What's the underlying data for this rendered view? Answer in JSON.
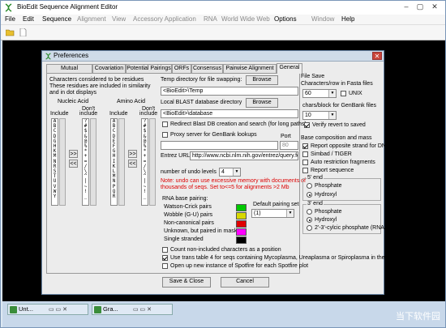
{
  "app": {
    "title": "BioEdit Sequence Alignment Editor"
  },
  "window_controls": {
    "minimize": "–",
    "maximize": "▢",
    "close": "✕"
  },
  "menu": [
    "File",
    "Edit",
    "Sequence",
    "Alignment",
    "View",
    "Accessory Application",
    "RNA",
    "World Wide Web",
    "Options",
    "Window",
    "Help"
  ],
  "dialog": {
    "title": "Preferences",
    "tabs": [
      "Mutual Information",
      "Covariation",
      "Potential Pairings",
      "ORFs",
      "Consensus",
      "Pairwise Alignment",
      "General"
    ],
    "residues": {
      "desc1": "Characters considered to be residues",
      "desc2": "These residues are included in similarity",
      "desc3": "and in dot displays",
      "nucleic": "Nucleic Acid",
      "amino": "Amino Acid",
      "include": "Include",
      "dont1": "Don't",
      "dont2": "include",
      "include_chars": "A\nB\nC\nD\nG\nH\nK\nM\nN\nR\nS\nT\nU\nV\nW\nY",
      "exclude_chars": "?\n#\n$\n&\n@\n%\n*\n+\n=\n/\n\\\n^\n|\n~\n!\n_",
      "aa_include_chars": "A\nB\nC\nD\nE\nF\nG\nH\nI\nK\nL\nM\nN\nP\nQ\nR",
      "aa_exclude_chars": "?\n#\n$\n&\n@\n%\n*\n+\n=\n/\n\\\n^\n|\n~\n!\n_",
      "move_right": ">>",
      "move_left": "<<"
    },
    "temp_dir": {
      "label": "Temp directory for file swapping:",
      "browse": "Browse",
      "value": "<BioEdit>\\Temp"
    },
    "blast_dir": {
      "label": "Local BLAST database directory",
      "browse": "Browse",
      "value": "<BioEdit>\\database"
    },
    "redirect_blast": "Redirect Blast DB creation and search (for long paths)",
    "proxy": {
      "label": "Proxy server for GenBank lookups",
      "port_label": "Port",
      "port_value": "80"
    },
    "entrez": {
      "label": "Entrez URL",
      "value": "http://www.ncbi.nlm.nih.gov/entrez/query.fcgi"
    },
    "undo": {
      "label": "number of undo levels",
      "value": "4",
      "note1": "Note: undo can use excessive memory with documents of",
      "note2": "thousands of seqs. Set to<=5 for alignments >2 Mb"
    },
    "rna_pairing": {
      "title": "RNA base pairing:",
      "default_label": "Default pairing set",
      "default_value": "(1)",
      "rows": [
        {
          "label": "Watson-Crick pairs",
          "color": "#00c800"
        },
        {
          "label": "Wobble (G-U) pairs",
          "color": "#d8d800"
        },
        {
          "label": "Non-canonical pairs",
          "color": "#e00000"
        },
        {
          "label": "Unknown, but paired in mask",
          "color": "#ff00ff"
        },
        {
          "label": "Single stranded",
          "color": "#000000"
        }
      ]
    },
    "options": [
      {
        "label": "Count non-included characters as a position",
        "checked": false
      },
      {
        "label": "Use trans table 4 for seqs containing Mycoplasma, Ureaplasma or Spiroplasma in the titles",
        "checked": true
      },
      {
        "label": "Open up new instance of Spotfire for each Spotfire plot",
        "checked": false
      }
    ],
    "file_save": {
      "title": "File Save",
      "row_label": "Characters/row in Fasta files",
      "row_value": "60",
      "unix": "UNIX",
      "chars_label": "chars/block for GenBank files",
      "chars_value": "10",
      "verify": "Verify revert to saved"
    },
    "base_comp": {
      "title": "Base composition and mass",
      "items": [
        {
          "label": "Report opposite strand for DNA",
          "checked": true
        },
        {
          "label": "Simbad / TIGER",
          "checked": false
        },
        {
          "label": "Auto restriction fragments",
          "checked": false
        },
        {
          "label": "Report sequence",
          "checked": false
        }
      ]
    },
    "end5": {
      "title": "5' end",
      "options": [
        "Phosphate",
        "Hydroxyl"
      ],
      "selected": 1
    },
    "end3": {
      "title": "3' end",
      "options": [
        "Phosphate",
        "Hydroxyl",
        "2'-3'-cylcic phosphate (RNA)"
      ],
      "selected": 1
    },
    "save_close": "Save & Close",
    "cancel": "Cancel"
  },
  "taskbar": [
    {
      "label": "Unt..."
    },
    {
      "label": "Gra..."
    }
  ],
  "watermark": "当下软件园"
}
